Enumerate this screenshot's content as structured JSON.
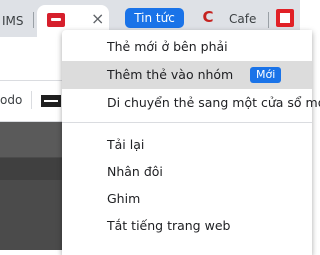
{
  "tabs": {
    "ims_label": "IMS",
    "close_glyph": "×",
    "tintuc_label": "Tin tức",
    "cafe_label": "Cafe",
    "c_glyph": "C"
  },
  "bookmarks": {
    "odo_label": "odo"
  },
  "context_menu": {
    "items": [
      {
        "label": "Thẻ mới ở bên phải"
      },
      {
        "label": "Thêm thẻ vào nhóm",
        "badge": "Mới"
      },
      {
        "label": "Di chuyển thẻ sang một cửa sổ mới"
      },
      {
        "label": "Tải lại"
      },
      {
        "label": "Nhân đôi"
      },
      {
        "label": "Ghim"
      },
      {
        "label": "Tắt tiếng trang web"
      }
    ]
  },
  "icons": {
    "active_tab_favicon": "red-tab-favicon-icon",
    "cafe_favicon": "c-favicon-icon",
    "last_tab_favicon": "flipboard-favicon-icon",
    "bookmark_favicon": "dark-bookmark-icon"
  },
  "colors": {
    "accent": "#1a73e8",
    "highlight": "#dcdcdc",
    "tabstrip": "#dee1e6",
    "brand_red": "#d61f2c"
  }
}
